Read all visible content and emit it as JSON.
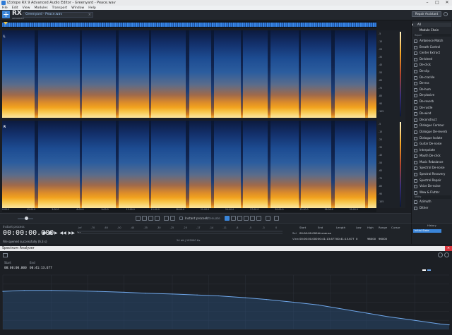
{
  "window": {
    "title": "iZotope RX 9 Advanced Audio Editor - Greenyard - Peace.wav"
  },
  "menu": [
    "File",
    "Edit",
    "View",
    "Modules",
    "Transport",
    "Window",
    "Help"
  ],
  "header": {
    "logo_text": "RX",
    "logo_sub": "ADVANCED",
    "doc_tab_label": "Greenyard - Peace.wav",
    "repair_assistant_label": "Repair Assistant"
  },
  "spectrogram": {
    "channel_labels": [
      "L",
      "R"
    ],
    "time_ticks": [
      "0:00:0",
      "15:00.0",
      "30:00.0",
      "45:00.0",
      "1:00.0",
      "2:00.0",
      "3:00.0",
      "4:00.0",
      "5:00.0",
      "6:00.0",
      "7:00.0",
      "8:00.0",
      "9:00.0",
      "10:00.0",
      "11:00.0",
      "12:00.0",
      "13:00.0",
      "14:00.0",
      "15:00.0",
      "16:00.0",
      "17:00.0",
      "18:00.0",
      "19:00.0",
      "20:00.0",
      "21:00.0",
      "22:00.0",
      "23:00.0",
      "24:00.0",
      "25:00.0",
      "26:00.0",
      "27:00.0",
      "28:00.0",
      "29:00.0",
      "30:00.0",
      "31:00.0",
      "32:00.0",
      "33:00.0",
      "34:00.0",
      "35:00.0",
      "36:00.0",
      "37:00.0",
      "38:00.0",
      "39:00.0",
      "40:00.0",
      "41:00.0"
    ],
    "db_ticks": [
      "-5",
      "-10",
      "-15",
      "-20",
      "-25",
      "-30",
      "-35",
      "-40",
      "-45",
      "-50",
      "-55",
      "-60",
      "-65",
      "-70",
      "-75",
      "-80",
      "-85",
      "-90",
      "-95",
      "-100",
      "-105",
      "-110",
      "-115"
    ]
  },
  "toolbar": {
    "instant_process_label": "Instant process",
    "attenuate_label": "Attenuate"
  },
  "info": {
    "instant_process_label": "Instant process",
    "time": "00:00:00.000",
    "status": "File opened successfully (6.3 s)",
    "meter_ticks": [
      "-Inf",
      "-70",
      "-60",
      "-50",
      "-40",
      "-35",
      "-30",
      "-25",
      "-20",
      "-17",
      "-14",
      "-11",
      "-8",
      "-5",
      "-3",
      "0"
    ],
    "bit_depth": "24 bit | 192000 Hz",
    "start_label": "Start",
    "end_label": "End",
    "length_label": "Length",
    "low_label": "Low",
    "high_label": "High",
    "range_label": "Range",
    "cursor_label": "Cursor",
    "sel_label": "Sel",
    "view_label": "View",
    "sel_start": "00:00:00.000",
    "view_start": "00:00:00.000",
    "view_end": "00:41:13.677",
    "view_length": "00:41:13.677",
    "sel_end": "hh:mm:ss",
    "low_val": "0",
    "high_val": "96000",
    "range_val": "96000"
  },
  "right_panel": {
    "mode_label": "All",
    "module_chain_label": "Module Chain",
    "repair_section": "Repair",
    "modules": [
      "Ambience Match",
      "Breath Control",
      "Center Extract",
      "De-bleed",
      "De-click",
      "De-clip",
      "De-crackle",
      "De-ess",
      "De-hum",
      "De-plosive",
      "De-reverb",
      "De-rustle",
      "De-wind",
      "Deconstruct",
      "Dialogue Contour",
      "Dialogue De-reverb",
      "Dialogue Isolate",
      "Guitar De-noise",
      "Interpolate",
      "Mouth De-click",
      "Music Rebalance",
      "Spectral De-noise",
      "Spectral Recovery",
      "Spectral Repair",
      "Voice De-noise",
      "Wow & Flutter"
    ],
    "utility_section": "Utility",
    "utility_modules": [
      "Azimuth",
      "Dither"
    ],
    "history_title": "History",
    "history_item": "Initial State"
  },
  "spectrum_analyzer": {
    "title": "Spectrum Analyzer",
    "start_label": "Start",
    "end_label": "End",
    "start_time": "00:00:00.000",
    "end_time": "00:41:13.677"
  },
  "chart_data": {
    "type": "line",
    "xscale": "log",
    "x": [
      20,
      30,
      50,
      80,
      120,
      200,
      300,
      500,
      800,
      1200,
      2000,
      3000,
      5000,
      8000,
      12000,
      20000,
      30000,
      50000,
      80000,
      96000
    ],
    "series": [
      {
        "values": [
          -18,
          -17,
          -17,
          -17.5,
          -18,
          -19,
          -20,
          -21,
          -22,
          -23,
          -25,
          -27,
          -30,
          -33,
          -37,
          -42,
          -46,
          -50,
          -54,
          -55
        ]
      }
    ],
    "ylim": [
      -60,
      0
    ],
    "xlim": [
      20,
      96000
    ],
    "grid": true,
    "legend_placement": "top-right",
    "colors": {
      "line": "#6fa7ea",
      "fill": "#2b4f7d"
    }
  }
}
